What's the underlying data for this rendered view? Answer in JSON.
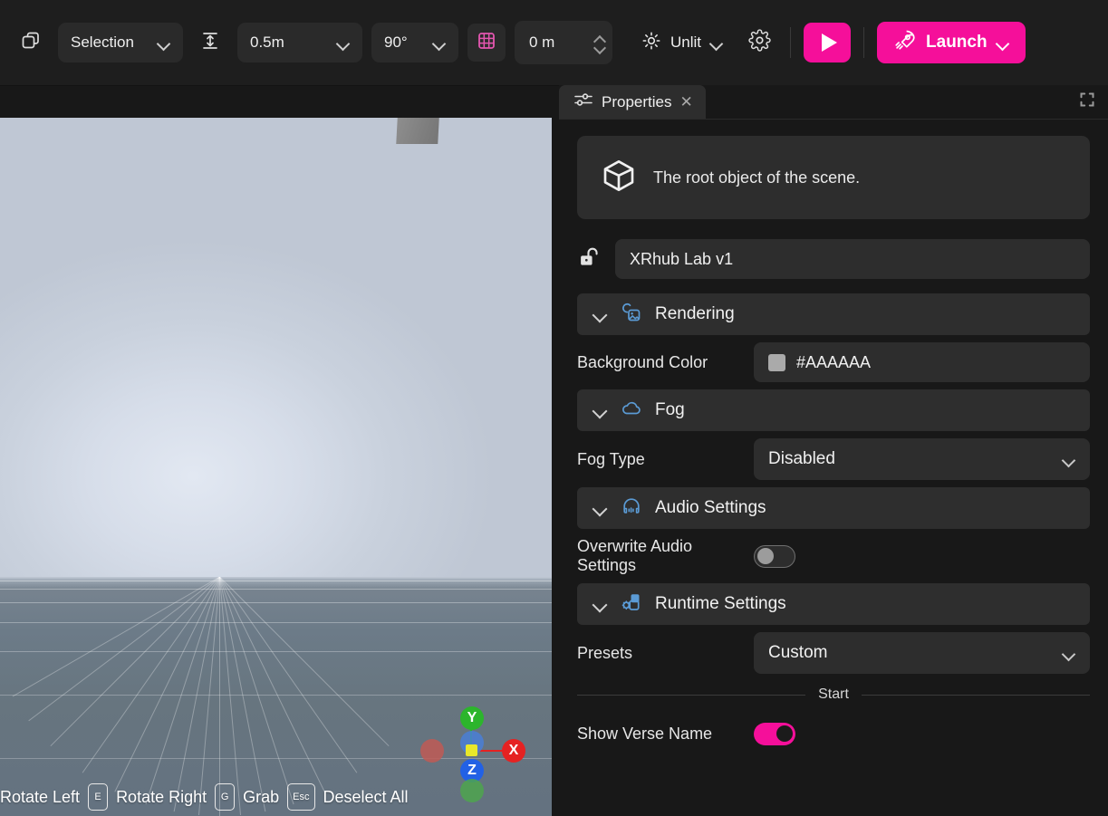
{
  "toolbar": {
    "duplicate_icon": "overlapping-squares-icon",
    "selection_mode": "Selection",
    "height_snap_icon": "vertical-snap-icon",
    "grid_size": "0.5m",
    "rotation_snap": "90°",
    "grid_toggle_icon": "grid-icon",
    "elevation_value": "0 m",
    "lighting_icon": "sun-icon",
    "lighting_mode": "Unlit",
    "settings_icon": "gear-icon",
    "play_icon": "play-icon",
    "launch_icon": "rocket-icon",
    "launch_label": "Launch",
    "accent_color": "#f50f9a"
  },
  "viewport": {
    "expand_icon": "expand-icon",
    "hints": [
      {
        "key": "",
        "label": "Rotate Left"
      },
      {
        "key": "E",
        "label": "Rotate Right"
      },
      {
        "key": "G",
        "label": "Grab"
      },
      {
        "key": "Esc",
        "label": "Deselect All"
      }
    ],
    "gizmo": {
      "y_label": "Y",
      "x_label": "X",
      "z_label": "Z",
      "y_color": "#2cb52c",
      "x_color": "#e52222",
      "z_color": "#2261e5",
      "origin_color": "#e8e82a"
    },
    "sky_color": "#c9d1dd",
    "ground_color": "#6c7b88"
  },
  "panel": {
    "tab_icon": "sliders-icon",
    "tab_label": "Properties",
    "close_icon": "close-icon",
    "expand_icon": "expand-icon",
    "description_icon": "cube-icon",
    "description": "The root object of the scene.",
    "lock_icon": "unlock-icon",
    "object_name": "XRhub Lab v1",
    "sections": {
      "rendering": {
        "icon": "rendering-image-icon",
        "title": "Rendering",
        "background_color_label": "Background Color",
        "background_color_value": "#AAAAAA",
        "background_color_swatch": "#aaaaaa"
      },
      "fog": {
        "icon": "cloud-icon",
        "title": "Fog",
        "fog_type_label": "Fog Type",
        "fog_type_value": "Disabled"
      },
      "audio": {
        "icon": "headphones-icon",
        "title": "Audio Settings",
        "overwrite_label": "Overwrite Audio Settings",
        "overwrite_state": "off"
      },
      "runtime": {
        "icon": "runtime-gear-icon",
        "title": "Runtime Settings",
        "presets_label": "Presets",
        "presets_value": "Custom",
        "start_divider_label": "Start",
        "show_verse_name_label": "Show Verse Name",
        "show_verse_name_state": "on"
      }
    }
  }
}
